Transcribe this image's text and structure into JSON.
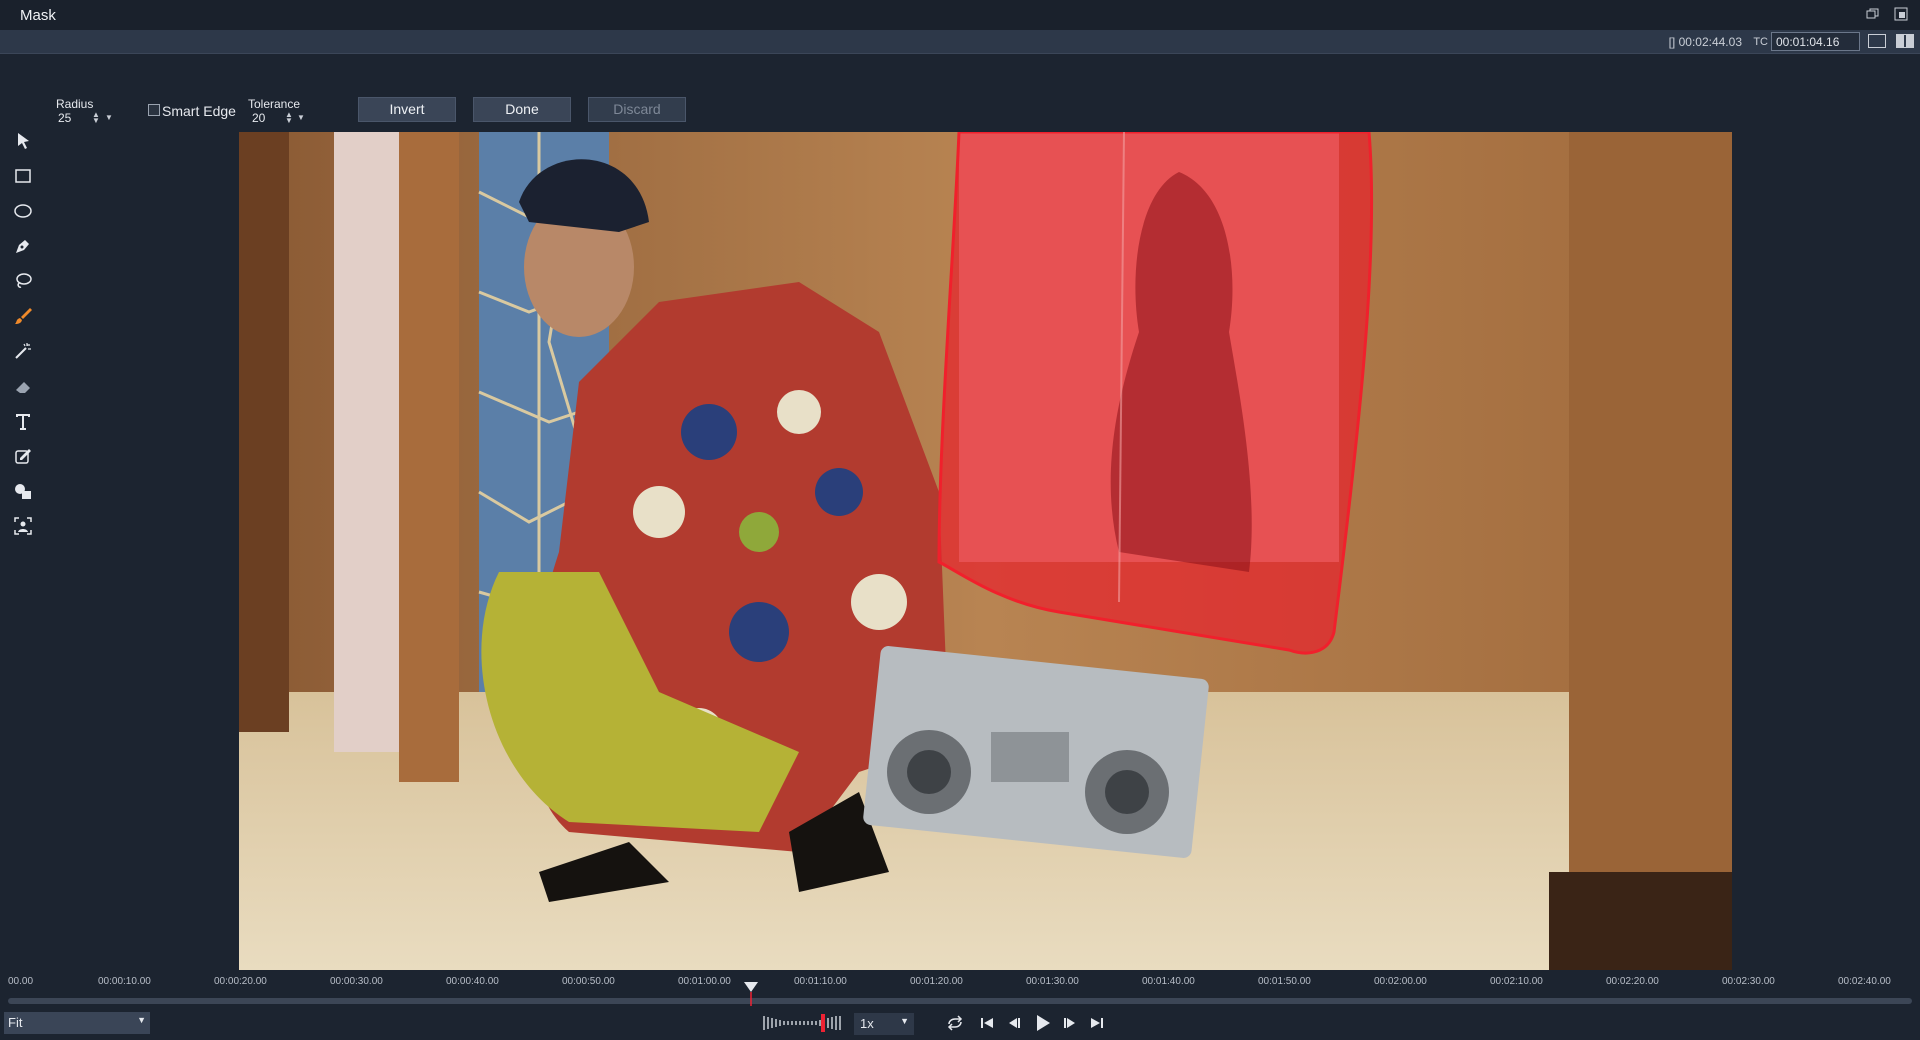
{
  "window": {
    "title": "Mask"
  },
  "info_bar": {
    "duration_icon": "[]",
    "duration": "00:02:44.03",
    "tc_label": "TC",
    "timecode": "00:01:04.16"
  },
  "tools": [
    {
      "name": "select-tool-icon"
    },
    {
      "name": "rectangle-tool-icon"
    },
    {
      "name": "ellipse-tool-icon"
    },
    {
      "name": "pen-tool-icon"
    },
    {
      "name": "lasso-tool-icon"
    },
    {
      "name": "brush-tool-icon"
    },
    {
      "name": "magic-wand-tool-icon"
    },
    {
      "name": "eraser-tool-icon"
    },
    {
      "name": "text-tool-icon"
    },
    {
      "name": "edit-tool-icon"
    },
    {
      "name": "shapes-tool-icon"
    },
    {
      "name": "person-detect-tool-icon"
    }
  ],
  "options": {
    "radius_label": "Radius",
    "radius_value": "25",
    "smart_edge_label": "Smart Edge",
    "smart_edge_checked": false,
    "tolerance_label": "Tolerance",
    "tolerance_value": "20"
  },
  "buttons": {
    "invert": "Invert",
    "done": "Done",
    "discard": "Discard"
  },
  "timeline": {
    "ticks": [
      "00.00",
      "00:00:10.00",
      "00:00:20.00",
      "00:00:30.00",
      "00:00:40.00",
      "00:00:50.00",
      "00:01:00.00",
      "00:01:10.00",
      "00:01:20.00",
      "00:01:30.00",
      "00:01:40.00",
      "00:01:50.00",
      "00:02:00.00",
      "00:02:10.00",
      "00:02:20.00",
      "00:02:30.00",
      "00:02:40.00"
    ],
    "playhead_fraction": 0.39
  },
  "bottom": {
    "zoom": "Fit",
    "speed": "1x"
  },
  "colors": {
    "accent_brush": "#f08a2a",
    "mask_overlay": "#e8232d"
  }
}
